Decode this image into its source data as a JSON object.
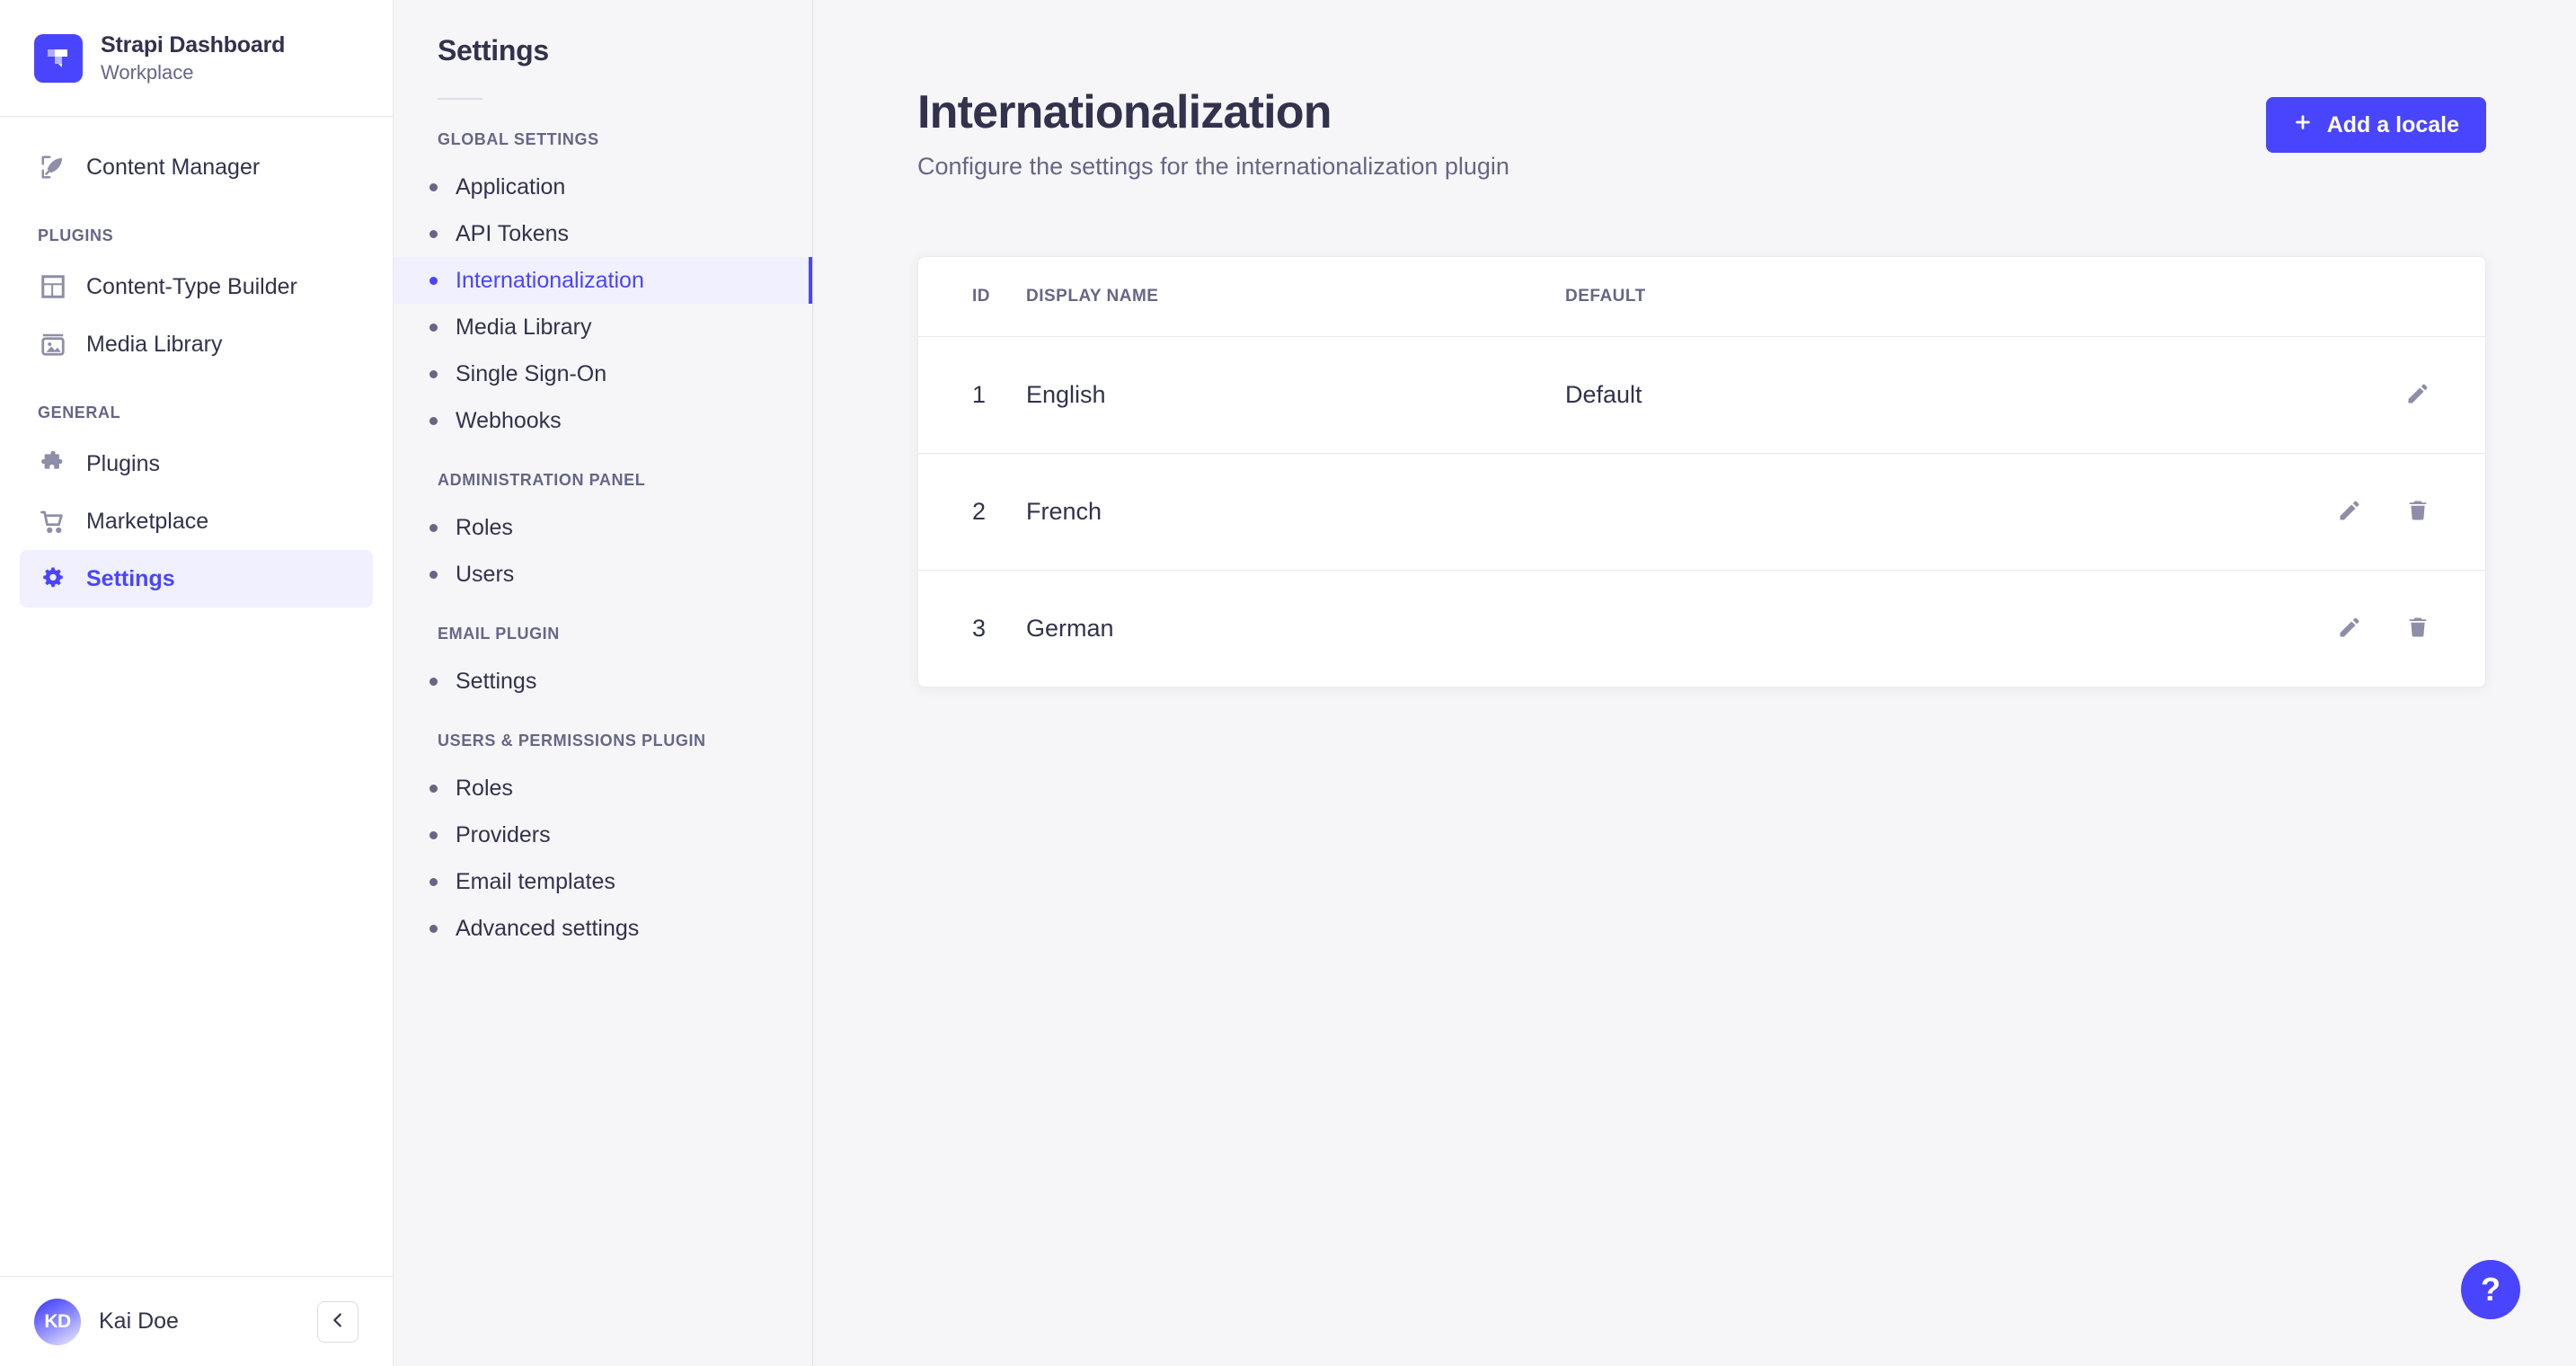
{
  "sidebar": {
    "brand": {
      "title": "Strapi Dashboard",
      "subtitle": "Workplace"
    },
    "top_items": [
      {
        "label": "Content Manager",
        "icon": "feather-icon"
      }
    ],
    "sections": [
      {
        "label": "PLUGINS",
        "items": [
          {
            "label": "Content-Type Builder",
            "icon": "layout-icon"
          },
          {
            "label": "Media Library",
            "icon": "image-icon"
          }
        ]
      },
      {
        "label": "GENERAL",
        "items": [
          {
            "label": "Plugins",
            "icon": "puzzle-icon"
          },
          {
            "label": "Marketplace",
            "icon": "cart-icon"
          },
          {
            "label": "Settings",
            "icon": "gear-icon"
          }
        ]
      }
    ],
    "footer": {
      "avatar_initials": "KD",
      "user_name": "Kai Doe",
      "collapse_label": "‹"
    }
  },
  "subnav": {
    "title": "Settings",
    "sections": [
      {
        "label": "GLOBAL SETTINGS",
        "items": [
          "Application",
          "API Tokens",
          "Internationalization",
          "Media Library",
          "Single Sign-On",
          "Webhooks"
        ]
      },
      {
        "label": "ADMINISTRATION PANEL",
        "items": [
          "Roles",
          "Users"
        ]
      },
      {
        "label": "EMAIL PLUGIN",
        "items": [
          "Settings"
        ]
      },
      {
        "label": "USERS & PERMISSIONS PLUGIN",
        "items": [
          "Roles",
          "Providers",
          "Email templates",
          "Advanced settings"
        ]
      }
    ],
    "active_item": "Internationalization"
  },
  "main": {
    "title": "Internationalization",
    "subtitle": "Configure the settings for the internationalization plugin",
    "add_button": {
      "label": "Add a locale",
      "icon": "plus-icon"
    },
    "table": {
      "columns": [
        "ID",
        "DISPLAY NAME",
        "DEFAULT",
        ""
      ],
      "rows": [
        {
          "id": "1",
          "display_name": "English",
          "default": "Default",
          "can_edit": true,
          "can_delete": false
        },
        {
          "id": "2",
          "display_name": "French",
          "default": "",
          "can_edit": true,
          "can_delete": true
        },
        {
          "id": "3",
          "display_name": "German",
          "default": "",
          "can_edit": true,
          "can_delete": true
        }
      ]
    },
    "help_button_label": "?"
  },
  "colors": {
    "accent": "#4945ff",
    "accent_bg": "#f0f0ff",
    "text_primary": "#32324d",
    "text_secondary": "#666687",
    "page_bg": "#f6f6f9",
    "border": "#eaeaef"
  }
}
